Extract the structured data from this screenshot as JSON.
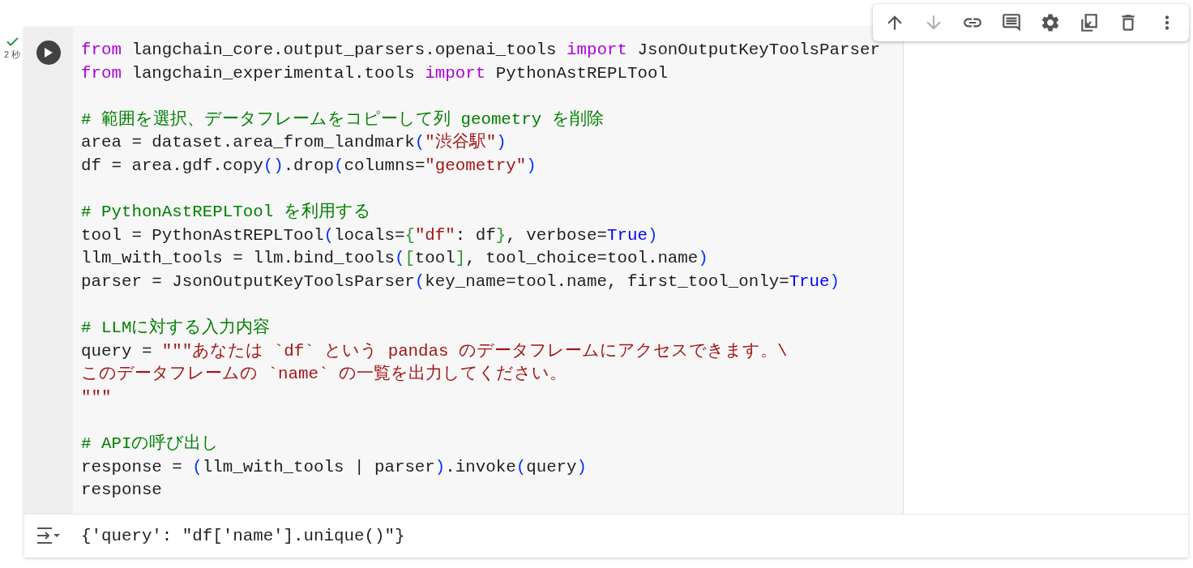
{
  "status": {
    "done": true,
    "duration": "2 秒"
  },
  "toolbar": [
    {
      "kind": "move-up",
      "disabled": false
    },
    {
      "kind": "move-down",
      "disabled": true
    },
    {
      "kind": "link",
      "disabled": false
    },
    {
      "kind": "comment",
      "disabled": false
    },
    {
      "kind": "settings",
      "disabled": false
    },
    {
      "kind": "mirror",
      "disabled": false
    },
    {
      "kind": "delete",
      "disabled": false
    },
    {
      "kind": "more",
      "disabled": false
    }
  ],
  "code_blocks": [
    {
      "lines": [
        [
          {
            "text": "from",
            "kind": "keyword"
          },
          {
            "text": " langchain_core.output_parsers.openai_tools ",
            "kind": "plain"
          },
          {
            "text": "import",
            "kind": "keyword"
          },
          {
            "text": " JsonOutputKeyToolsParser",
            "kind": "plain"
          }
        ],
        [
          {
            "text": "from",
            "kind": "keyword"
          },
          {
            "text": " langchain_experimental.tools ",
            "kind": "plain"
          },
          {
            "text": "import",
            "kind": "keyword"
          },
          {
            "text": " PythonAstREPLTool",
            "kind": "plain"
          }
        ]
      ]
    },
    {
      "lines": [
        [
          {
            "text": "# 範囲を選択、データフレームをコピーして列 geometry を削除",
            "kind": "comment"
          }
        ],
        [
          {
            "text": "area = dataset.area_from_landmark",
            "kind": "plain"
          },
          {
            "text": "(",
            "kind": "bracket1"
          },
          {
            "text": "\"渋谷駅\"",
            "kind": "string"
          },
          {
            "text": ")",
            "kind": "bracket1"
          }
        ],
        [
          {
            "text": "df = area.gdf.copy",
            "kind": "plain"
          },
          {
            "text": "()",
            "kind": "bracket1"
          },
          {
            "text": ".drop",
            "kind": "plain"
          },
          {
            "text": "(",
            "kind": "bracket1"
          },
          {
            "text": "columns=",
            "kind": "plain"
          },
          {
            "text": "\"geometry\"",
            "kind": "string"
          },
          {
            "text": ")",
            "kind": "bracket1"
          }
        ]
      ]
    },
    {
      "lines": [
        [
          {
            "text": "# PythonAstREPLTool を利用する",
            "kind": "comment"
          }
        ],
        [
          {
            "text": "tool = PythonAstREPLTool",
            "kind": "plain"
          },
          {
            "text": "(",
            "kind": "bracket1"
          },
          {
            "text": "locals=",
            "kind": "plain"
          },
          {
            "text": "{",
            "kind": "bracket2"
          },
          {
            "text": "\"df\"",
            "kind": "string"
          },
          {
            "text": ": df",
            "kind": "plain"
          },
          {
            "text": "}",
            "kind": "bracket2"
          },
          {
            "text": ", verbose=",
            "kind": "plain"
          },
          {
            "text": "True",
            "kind": "constant"
          },
          {
            "text": ")",
            "kind": "bracket1"
          }
        ],
        [
          {
            "text": "llm_with_tools = llm.bind_tools",
            "kind": "plain"
          },
          {
            "text": "(",
            "kind": "bracket1"
          },
          {
            "text": "[",
            "kind": "bracket2"
          },
          {
            "text": "tool",
            "kind": "plain"
          },
          {
            "text": "]",
            "kind": "bracket2"
          },
          {
            "text": ", tool_choice=tool.name",
            "kind": "plain"
          },
          {
            "text": ")",
            "kind": "bracket1"
          }
        ],
        [
          {
            "text": "parser = JsonOutputKeyToolsParser",
            "kind": "plain"
          },
          {
            "text": "(",
            "kind": "bracket1"
          },
          {
            "text": "key_name=tool.name, first_tool_only=",
            "kind": "plain"
          },
          {
            "text": "True",
            "kind": "constant"
          },
          {
            "text": ")",
            "kind": "bracket1"
          }
        ]
      ]
    },
    {
      "lines": [
        [
          {
            "text": "# LLMに対する入力内容",
            "kind": "comment"
          }
        ],
        [
          {
            "text": "query = ",
            "kind": "plain"
          },
          {
            "text": "\"\"\"あなたは `df` という pandas のデータフレームにアクセスできます。\\",
            "kind": "string"
          }
        ],
        [
          {
            "text": "このデータフレームの `name` の一覧を出力してください。",
            "kind": "string"
          }
        ],
        [
          {
            "text": "\"\"\"",
            "kind": "string"
          }
        ]
      ]
    },
    {
      "lines": [
        [
          {
            "text": "# APIの呼び出し",
            "kind": "comment"
          }
        ],
        [
          {
            "text": "response = ",
            "kind": "plain"
          },
          {
            "text": "(",
            "kind": "bracket1"
          },
          {
            "text": "llm_with_tools | parser",
            "kind": "plain"
          },
          {
            "text": ")",
            "kind": "bracket1"
          },
          {
            "text": ".invoke",
            "kind": "plain"
          },
          {
            "text": "(",
            "kind": "bracket1"
          },
          {
            "text": "query",
            "kind": "plain"
          },
          {
            "text": ")",
            "kind": "bracket1"
          }
        ],
        [
          {
            "text": "response",
            "kind": "plain"
          }
        ]
      ]
    }
  ],
  "output": {
    "text": "{'query': \"df['name'].unique()\"}"
  }
}
